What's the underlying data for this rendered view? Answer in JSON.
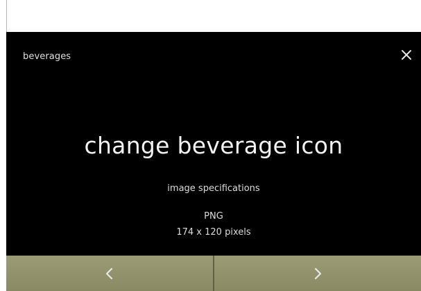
{
  "header": {
    "title": "beverages",
    "close_icon": "close-icon"
  },
  "main": {
    "title": "change beverage icon",
    "spec_label": "image specifications",
    "spec_format": "PNG",
    "spec_size": "174 x 120 pixels"
  },
  "navigation": {
    "prev_icon": "chevron-left-icon",
    "next_icon": "chevron-right-icon"
  },
  "colors": {
    "screen_background": "#000000",
    "text": "#e9e9e9",
    "nav_button": "#8f906a",
    "nav_icon": "#e8e8e8"
  }
}
